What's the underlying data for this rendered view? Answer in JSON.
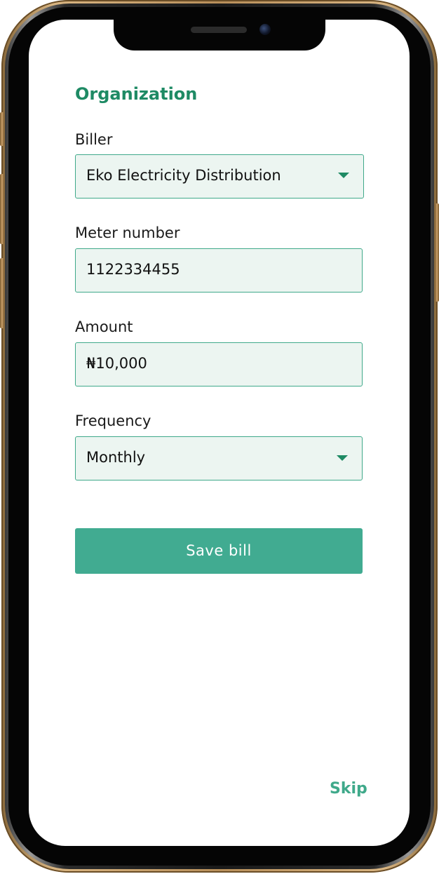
{
  "section_title": "Organization",
  "fields": {
    "biller": {
      "label": "Biller",
      "value": "Eko Electricity Distribution"
    },
    "meter_number": {
      "label": "Meter number",
      "value": "1122334455"
    },
    "amount": {
      "label": "Amount",
      "value": "₦10,000"
    },
    "frequency": {
      "label": "Frequency",
      "value": "Monthly"
    }
  },
  "actions": {
    "save_label": "Save bill",
    "skip_label": "Skip"
  },
  "icons": {
    "dropdown": "chevron-down-icon",
    "camera": "front-camera-icon"
  },
  "colors": {
    "accent": "#1e8a64",
    "button": "#41ab91",
    "field_bg": "#ecf5f1",
    "field_border": "#3fa98a"
  }
}
